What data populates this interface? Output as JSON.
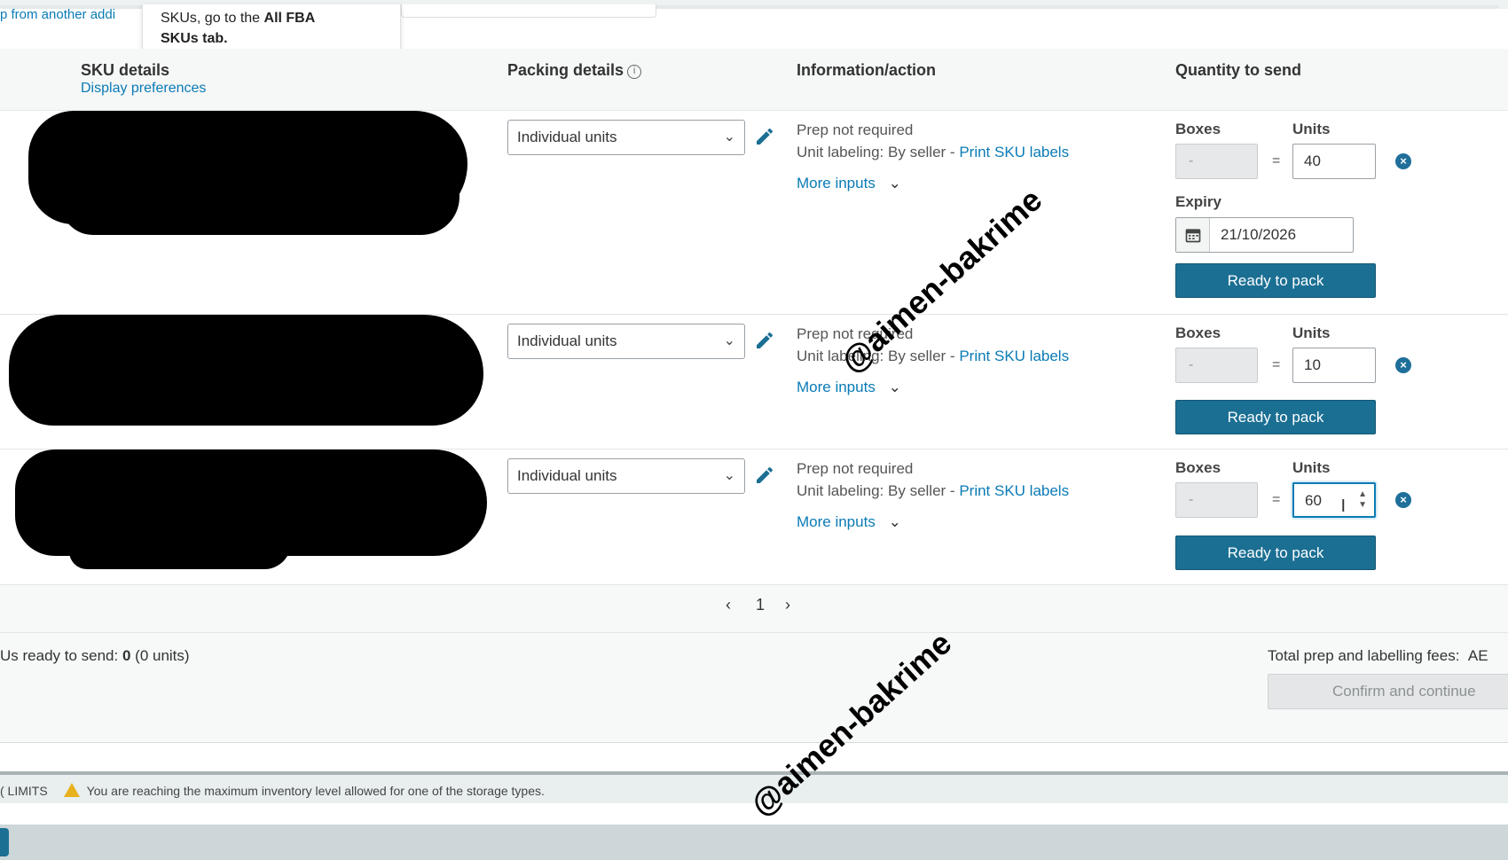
{
  "header": {
    "truncated_link": "p from another addi",
    "tooltip_text_prefix": "SKUs, go to the ",
    "tooltip_text_bold": "All FBA",
    "tooltip_text_line2": "SKUs tab."
  },
  "table": {
    "col_sku": "SKU details",
    "col_sku_link": "Display preferences",
    "col_packing": "Packing details",
    "col_info": "Information/action",
    "col_qty": "Quantity to send"
  },
  "rows": [
    {
      "packing": "Individual units",
      "prep": "Prep not required",
      "labeling_prefix": "Unit labeling: By seller - ",
      "labeling_link": "Print SKU labels",
      "more_inputs": "More inputs",
      "boxes_label": "Boxes",
      "units_label": "Units",
      "boxes_value": "-",
      "equals": "=",
      "units_value": "40",
      "expiry_label": "Expiry",
      "expiry_value": "21/10/2026",
      "ready_button": "Ready to pack"
    },
    {
      "packing": "Individual units",
      "prep": "Prep not required",
      "labeling_prefix": "Unit labeling: By seller - ",
      "labeling_link": "Print SKU labels",
      "more_inputs": "More inputs",
      "boxes_label": "Boxes",
      "units_label": "Units",
      "boxes_value": "-",
      "equals": "=",
      "units_value": "10",
      "ready_button": "Ready to pack"
    },
    {
      "packing": "Individual units",
      "prep": "Prep not required",
      "labeling_prefix": "Unit labeling: By seller - ",
      "labeling_link": "Print SKU labels",
      "more_inputs": "More inputs",
      "boxes_label": "Boxes",
      "units_label": "Units",
      "boxes_value": "-",
      "equals": "=",
      "units_value": "60",
      "ready_button": "Ready to pack"
    }
  ],
  "pagination": {
    "prev": "‹",
    "page": "1",
    "next": "›"
  },
  "summary": {
    "ready_label": "Us ready to send: ",
    "ready_count": "0",
    "ready_units": " (0 units)",
    "fees_label": "Total prep and labelling fees:",
    "fees_value": "AE",
    "confirm_button": "Confirm and continue"
  },
  "limits": {
    "label": "( LIMITS",
    "message": "You are reaching the maximum inventory level allowed for one of the storage types."
  },
  "watermark": "@aimen-bakrime",
  "colors": {
    "link": "#0a7bb5",
    "primary_button": "#1b6f93",
    "warning": "#e8b21e"
  }
}
